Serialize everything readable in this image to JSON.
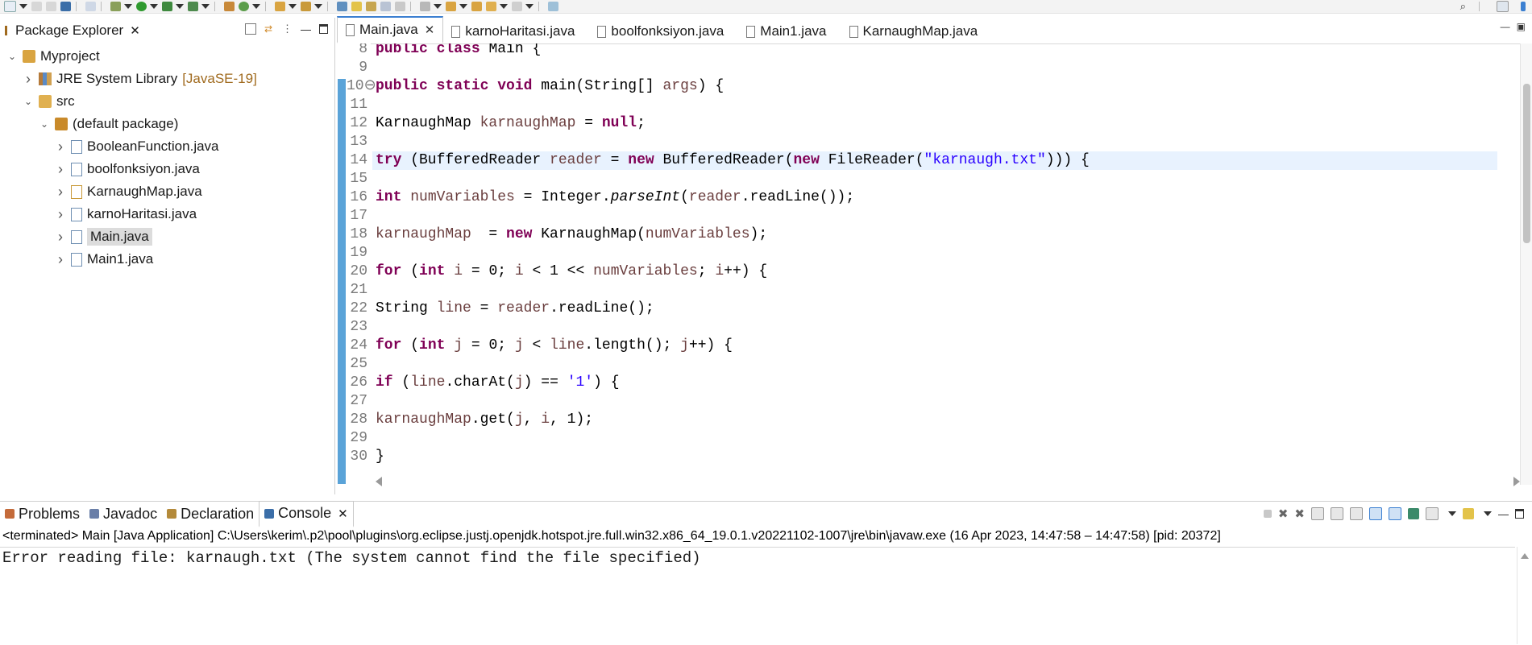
{
  "toolbar": {
    "colors": {
      "run": "#2f9a2f",
      "debug": "#6b8e23",
      "folder": "#d9a441",
      "blue": "#3b7fd1"
    }
  },
  "package_explorer": {
    "title": "Package Explorer",
    "tree": [
      {
        "label": "Myproject",
        "level": 0,
        "expanded": true,
        "icon": "project-icon"
      },
      {
        "label": "JRE System Library",
        "decoration": "[JavaSE-19]",
        "level": 1,
        "expanded": false,
        "icon": "library-icon"
      },
      {
        "label": "src",
        "level": 1,
        "expanded": true,
        "icon": "source-folder-icon"
      },
      {
        "label": "(default package)",
        "level": 2,
        "expanded": true,
        "icon": "package-icon"
      },
      {
        "label": "BooleanFunction.java",
        "level": 3,
        "expanded": false,
        "icon": "java-file-icon"
      },
      {
        "label": "boolfonksiyon.java",
        "level": 3,
        "expanded": false,
        "icon": "java-file-icon"
      },
      {
        "label": "KarnaughMap.java",
        "level": 3,
        "expanded": false,
        "icon": "java-file-warning-icon"
      },
      {
        "label": "karnoHaritasi.java",
        "level": 3,
        "expanded": false,
        "icon": "java-file-icon"
      },
      {
        "label": "Main.java",
        "level": 3,
        "expanded": false,
        "icon": "java-file-icon",
        "selected": true
      },
      {
        "label": "Main1.java",
        "level": 3,
        "expanded": false,
        "icon": "java-file-icon"
      }
    ]
  },
  "editor": {
    "tabs": [
      {
        "label": "Main.java",
        "active": true
      },
      {
        "label": "karnoHaritasi.java",
        "active": false
      },
      {
        "label": "boolfonksiyon.java",
        "active": false
      },
      {
        "label": "Main1.java",
        "active": false
      },
      {
        "label": "KarnaughMap.java",
        "active": false
      }
    ],
    "lines": [
      {
        "n": "8",
        "code": [
          [
            "kw",
            "public"
          ],
          [
            "t",
            " "
          ],
          [
            "kw",
            "class"
          ],
          [
            "t",
            " Main {"
          ]
        ]
      },
      {
        "n": "9",
        "code": []
      },
      {
        "n": "10⊖",
        "code": [
          [
            "kw",
            "public"
          ],
          [
            "t",
            " "
          ],
          [
            "kw",
            "static"
          ],
          [
            "t",
            " "
          ],
          [
            "kw",
            "void"
          ],
          [
            "t",
            " main(String[] "
          ],
          [
            "var",
            "args"
          ],
          [
            "t",
            ") {"
          ]
        ]
      },
      {
        "n": "11",
        "code": []
      },
      {
        "n": "12",
        "code": [
          [
            "t",
            "KarnaughMap "
          ],
          [
            "var",
            "karnaughMap"
          ],
          [
            "t",
            " = "
          ],
          [
            "kw",
            "null"
          ],
          [
            "t",
            ";"
          ]
        ]
      },
      {
        "n": "13",
        "code": []
      },
      {
        "n": "14",
        "current": true,
        "code": [
          [
            "kw",
            "try"
          ],
          [
            "t",
            " (BufferedReader "
          ],
          [
            "var",
            "reader"
          ],
          [
            "t",
            " = "
          ],
          [
            "kw",
            "new"
          ],
          [
            "t",
            " BufferedReader("
          ],
          [
            "kw",
            "new"
          ],
          [
            "t",
            " FileReader("
          ],
          [
            "str",
            "\"karnaugh.txt\""
          ],
          [
            "t",
            ")))"
          ],
          [
            "t",
            " {"
          ]
        ]
      },
      {
        "n": "15",
        "code": []
      },
      {
        "n": "16",
        "code": [
          [
            "kw",
            "int"
          ],
          [
            "t",
            " "
          ],
          [
            "var",
            "numVariables"
          ],
          [
            "t",
            " = Integer."
          ],
          [
            "it",
            "parseInt"
          ],
          [
            "t",
            "("
          ],
          [
            "var",
            "reader"
          ],
          [
            "t",
            ".readLine());"
          ]
        ]
      },
      {
        "n": "17",
        "code": []
      },
      {
        "n": "18",
        "code": [
          [
            "var",
            "karnaughMap"
          ],
          [
            "t",
            "  = "
          ],
          [
            "kw",
            "new"
          ],
          [
            "t",
            " KarnaughMap("
          ],
          [
            "var",
            "numVariables"
          ],
          [
            "t",
            ");"
          ]
        ]
      },
      {
        "n": "19",
        "code": []
      },
      {
        "n": "20",
        "code": [
          [
            "kw",
            "for"
          ],
          [
            "t",
            " ("
          ],
          [
            "kw",
            "int"
          ],
          [
            "t",
            " "
          ],
          [
            "var",
            "i"
          ],
          [
            "t",
            " = 0; "
          ],
          [
            "var",
            "i"
          ],
          [
            "t",
            " < 1 << "
          ],
          [
            "var",
            "numVariables"
          ],
          [
            "t",
            "; "
          ],
          [
            "var",
            "i"
          ],
          [
            "t",
            "++) {"
          ]
        ]
      },
      {
        "n": "21",
        "code": []
      },
      {
        "n": "22",
        "code": [
          [
            "t",
            "String "
          ],
          [
            "var",
            "line"
          ],
          [
            "t",
            " = "
          ],
          [
            "var",
            "reader"
          ],
          [
            "t",
            ".readLine();"
          ]
        ]
      },
      {
        "n": "23",
        "code": []
      },
      {
        "n": "24",
        "code": [
          [
            "kw",
            "for"
          ],
          [
            "t",
            " ("
          ],
          [
            "kw",
            "int"
          ],
          [
            "t",
            " "
          ],
          [
            "var",
            "j"
          ],
          [
            "t",
            " = 0; "
          ],
          [
            "var",
            "j"
          ],
          [
            "t",
            " < "
          ],
          [
            "var",
            "line"
          ],
          [
            "t",
            ".length(); "
          ],
          [
            "var",
            "j"
          ],
          [
            "t",
            "++) {"
          ]
        ]
      },
      {
        "n": "25",
        "code": []
      },
      {
        "n": "26",
        "code": [
          [
            "kw",
            "if"
          ],
          [
            "t",
            " ("
          ],
          [
            "var",
            "line"
          ],
          [
            "t",
            ".charAt("
          ],
          [
            "var",
            "j"
          ],
          [
            "t",
            ") == "
          ],
          [
            "str",
            "'1'"
          ],
          [
            "t",
            ") {"
          ]
        ]
      },
      {
        "n": "27",
        "code": []
      },
      {
        "n": "28",
        "code": [
          [
            "var",
            "karnaughMap"
          ],
          [
            "t",
            ".get("
          ],
          [
            "var",
            "j"
          ],
          [
            "t",
            ", "
          ],
          [
            "var",
            "i"
          ],
          [
            "t",
            ", 1);"
          ]
        ]
      },
      {
        "n": "29",
        "code": []
      },
      {
        "n": "30",
        "code": [
          [
            "t",
            "}"
          ]
        ]
      }
    ]
  },
  "bottom": {
    "tabs": [
      {
        "label": "Problems",
        "active": false,
        "icon": "problems-icon"
      },
      {
        "label": "Javadoc",
        "active": false,
        "icon": "javadoc-icon"
      },
      {
        "label": "Declaration",
        "active": false,
        "icon": "declaration-icon"
      },
      {
        "label": "Console",
        "active": true,
        "icon": "console-icon"
      }
    ],
    "terminated": "<terminated> Main [Java Application] C:\\Users\\kerim\\.p2\\pool\\plugins\\org.eclipse.justj.openjdk.hotspot.jre.full.win32.x86_64_19.0.1.v20221102-1007\\jre\\bin\\javaw.exe  (16 Apr 2023, 14:47:58 – 14:47:58) [pid: 20372]",
    "output": "Error reading file: karnaugh.txt (The system cannot find the file specified)"
  }
}
